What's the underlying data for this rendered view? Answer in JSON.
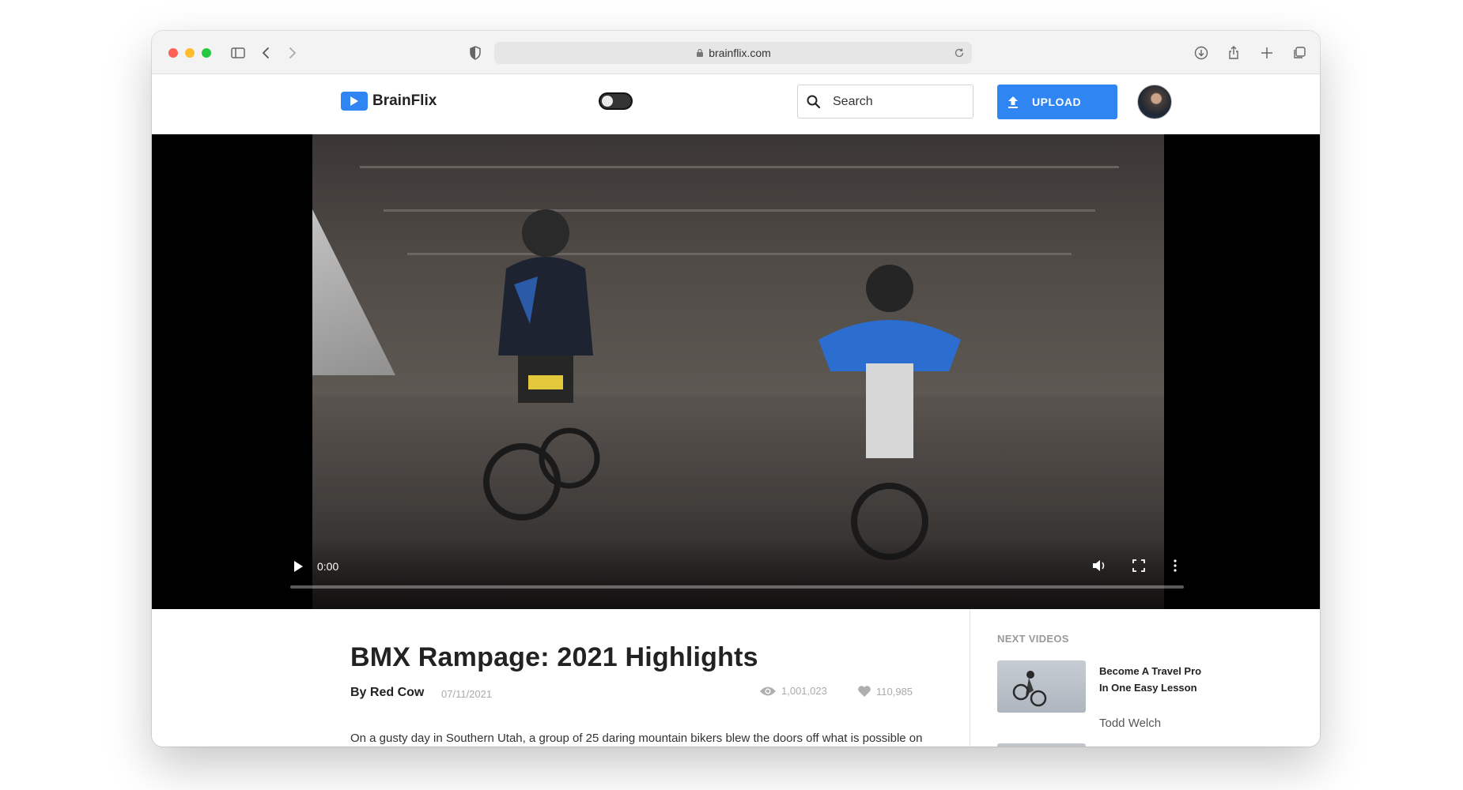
{
  "browser": {
    "url": "brainflix.com"
  },
  "site": {
    "brand": "BrainFlix",
    "search_placeholder": "Search",
    "upload_label": "UPLOAD"
  },
  "player": {
    "current_time": "0:00",
    "progress_fraction": 0.0
  },
  "video": {
    "title": "BMX Rampage: 2021 Highlights",
    "author": "By Red Cow",
    "date": "07/11/2021",
    "views": "1,001,023",
    "likes": "110,985",
    "description": "On a gusty day in Southern Utah, a group of 25 daring mountain bikers blew the doors off what is possible on"
  },
  "sidebar": {
    "heading": "NEXT VIDEOS",
    "items": [
      {
        "title": "Become A Travel Pro In One Easy Lesson",
        "channel": "Todd Welch"
      }
    ]
  },
  "colors": {
    "accent": "#2f86f3",
    "traffic_red": "#fe5f57",
    "traffic_yellow": "#febc2e",
    "traffic_green": "#28c840"
  }
}
